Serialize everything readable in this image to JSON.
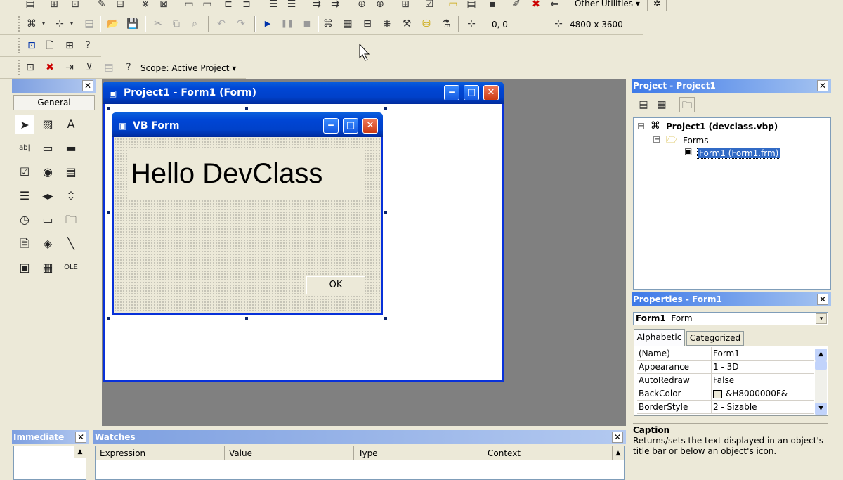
{
  "toolbar": {
    "other_utilities": "Other Utilities",
    "coords": "0, 0",
    "size": "4800 x 3600",
    "scope": "Scope: Active Project"
  },
  "toolbox": {
    "tab": "General",
    "tools": [
      "pointer-icon",
      "picturebox-icon",
      "label-icon",
      "textbox-icon",
      "frame-icon",
      "commandbutton-icon",
      "checkbox-icon",
      "optionbutton-icon",
      "combobox-icon",
      "listbox-icon",
      "hscrollbar-icon",
      "vscrollbar-icon",
      "timer-icon",
      "drivelistbox-icon",
      "dirlistbox-icon",
      "filelistbox-icon",
      "shape-icon",
      "line-icon",
      "image-icon",
      "data-icon",
      "ole-icon"
    ]
  },
  "designer": {
    "title": "Project1 - Form1 (Form)",
    "form_title": "VB Form",
    "label_text": "Hello DevClass",
    "button_text": "OK"
  },
  "project": {
    "title": "Project - Project1",
    "root": "Project1 (devclass.vbp)",
    "folder": "Forms",
    "item": "Form1 (Form1.frm)"
  },
  "properties": {
    "title": "Properties - Form1",
    "object_name": "Form1",
    "object_type": "Form",
    "tab_alpha": "Alphabetic",
    "tab_cat": "Categorized",
    "rows": [
      {
        "k": "(Name)",
        "v": "Form1"
      },
      {
        "k": "Appearance",
        "v": "1 - 3D"
      },
      {
        "k": "AutoRedraw",
        "v": "False"
      },
      {
        "k": "BackColor",
        "v": "&H8000000F&"
      },
      {
        "k": "BorderStyle",
        "v": "2 - Sizable"
      }
    ],
    "desc_title": "Caption",
    "desc_text": "Returns/sets the text displayed in an object's title bar or below an object's icon."
  },
  "immediate": {
    "title": "Immediate"
  },
  "watches": {
    "title": "Watches",
    "columns": [
      "Expression",
      "Value",
      "Type",
      "Context"
    ]
  }
}
